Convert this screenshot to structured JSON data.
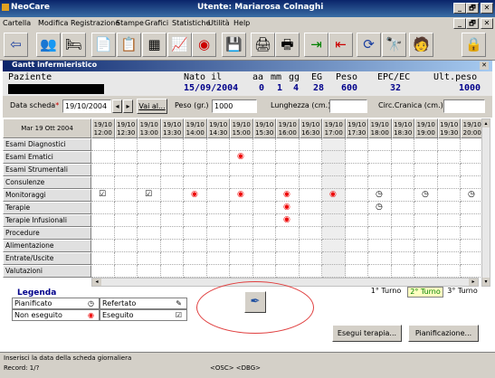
{
  "window": {
    "app_title": "NeoCare",
    "user_title": "Utente: Mariarosa Colnaghi",
    "min": "_",
    "max": "🗗",
    "close": "✕"
  },
  "menu": [
    "Cartella",
    "Modifica",
    "Registrazione",
    "Stampe",
    "Grafici",
    "Statistiche",
    "Utilità",
    "Help"
  ],
  "toolbar": [
    {
      "name": "back-icon",
      "glyph": "⇦"
    },
    {
      "name": "users-icon",
      "glyph": "👥"
    },
    {
      "name": "patients-icon",
      "glyph": "🛏"
    },
    {
      "name": "document-icon",
      "glyph": "📄"
    },
    {
      "name": "clipboard-icon",
      "glyph": "📋"
    },
    {
      "name": "calculator-icon",
      "glyph": "▦"
    },
    {
      "name": "chart-icon",
      "glyph": "📈"
    },
    {
      "name": "target-icon",
      "glyph": "◉"
    },
    {
      "name": "save-icon",
      "glyph": "💾"
    },
    {
      "name": "printer-icon",
      "glyph": "🖨"
    },
    {
      "name": "print-preview-icon",
      "glyph": "🖶"
    },
    {
      "name": "import-icon",
      "glyph": "⇥"
    },
    {
      "name": "export-icon",
      "glyph": "⇤"
    },
    {
      "name": "refresh-icon",
      "glyph": "⟳"
    },
    {
      "name": "binoculars-icon",
      "glyph": "🔭"
    },
    {
      "name": "help-icon",
      "glyph": "🧑"
    },
    {
      "name": "lock-icon",
      "glyph": "🔒"
    }
  ],
  "subwindow": {
    "title": "Gantt infermieristico",
    "close": "✕"
  },
  "patient": {
    "label": "Paziente",
    "nato_label": "Nato il",
    "nato": "15/09/2004",
    "aa_label": "aa",
    "aa": "0",
    "mm_label": "mm",
    "mm": "1",
    "gg_label": "gg",
    "gg": "4",
    "eg_label": "EG",
    "eg": "28",
    "peso_label": "Peso",
    "peso": "600",
    "epc_label": "EPC/EC",
    "epc": "32",
    "ult_label": "Ult.peso",
    "ult": "1000"
  },
  "form": {
    "data_label": "Data scheda",
    "data_req": "*",
    "data_value": "19/10/2004",
    "vai": "Vai al...",
    "peso_label": "Peso (gr.)",
    "peso_value": "1000",
    "lung_label": "Lunghezza (cm.)",
    "lung_value": "",
    "circ_label": "Circ.Cranica (cm.)",
    "circ_value": ""
  },
  "grid": {
    "date_header": "Mar 19 Ott 2004",
    "times": [
      "12:00",
      "12:30",
      "13:00",
      "13:30",
      "14:00",
      "14:30",
      "15:00",
      "15:30",
      "16:00",
      "16:30",
      "17:00",
      "17:30",
      "18:00",
      "18:30",
      "19:00",
      "19:30",
      "20:00"
    ],
    "day": "19/10",
    "rows": [
      "Esami Diagnostici",
      "Esami Ematici",
      "Esami Strumentali",
      "Consulenze",
      "Monitoraggi",
      "Terapie",
      "Terapie Infusionali",
      "Procedure",
      "Alimentazione",
      "Entrate/Uscite",
      "Valutazioni"
    ],
    "marks": [
      {
        "row": 1,
        "col": 6,
        "type": "nonexec"
      },
      {
        "row": 4,
        "col": 0,
        "type": "exec"
      },
      {
        "row": 4,
        "col": 2,
        "type": "exec"
      },
      {
        "row": 4,
        "col": 4,
        "type": "nonexec"
      },
      {
        "row": 4,
        "col": 6,
        "type": "nonexec"
      },
      {
        "row": 4,
        "col": 8,
        "type": "nonexec"
      },
      {
        "row": 4,
        "col": 10,
        "type": "nonexec"
      },
      {
        "row": 4,
        "col": 12,
        "type": "plan"
      },
      {
        "row": 4,
        "col": 14,
        "type": "plan"
      },
      {
        "row": 4,
        "col": 16,
        "type": "plan"
      },
      {
        "row": 5,
        "col": 8,
        "type": "nonexec"
      },
      {
        "row": 5,
        "col": 12,
        "type": "plan"
      },
      {
        "row": 6,
        "col": 8,
        "type": "nonexec"
      }
    ]
  },
  "legend": {
    "title": "Legenda",
    "pianificato": "Pianificato",
    "non_eseguito": "Non eseguito",
    "refertato": "Refertato",
    "eseguito": "Eseguito"
  },
  "turni": [
    "1° Turno",
    "2° Turno",
    "3° Turno"
  ],
  "buttons": {
    "esegui": "Esegui terapia...",
    "pianifica": "Pianificazione..."
  },
  "status": {
    "hint": "Inserisci la data della scheda giornaliera",
    "record": "Record: 1/?",
    "mid": "<OSC> <DBG>"
  }
}
